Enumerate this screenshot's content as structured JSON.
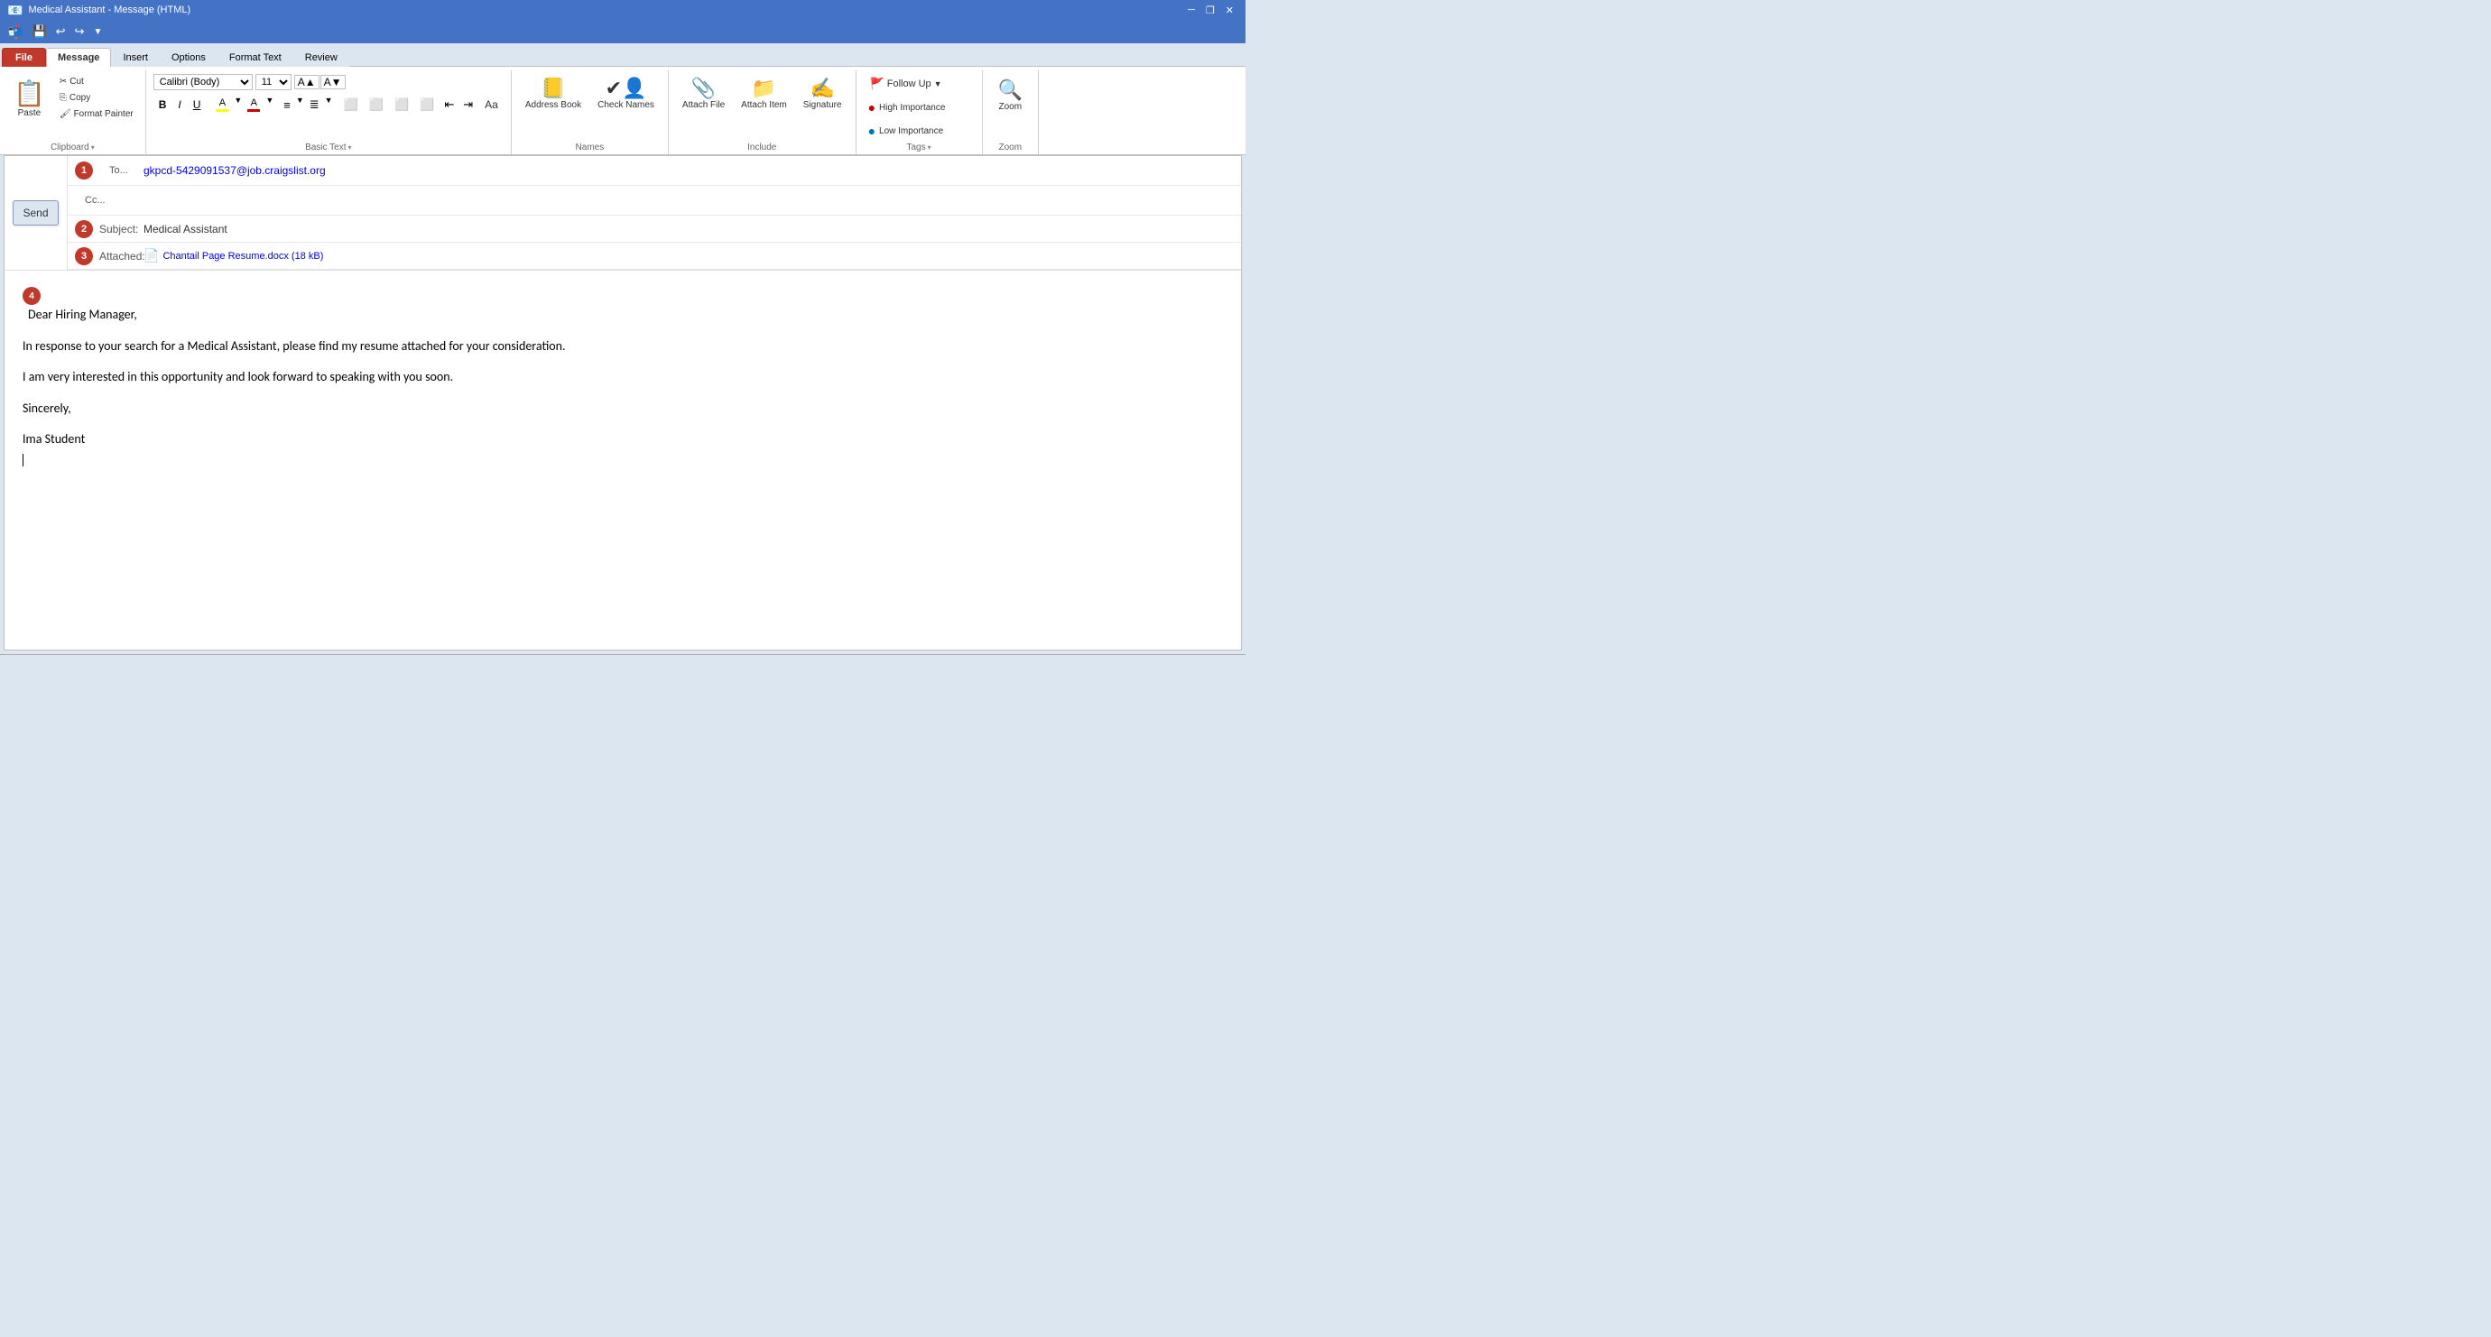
{
  "titlebar": {
    "title": "Medical Assistant - Message (HTML)",
    "controls": [
      "minimize",
      "restore",
      "close"
    ]
  },
  "quickaccess": {
    "buttons": [
      "save",
      "undo",
      "redo",
      "customize"
    ]
  },
  "ribbon": {
    "tabs": [
      "File",
      "Message",
      "Insert",
      "Options",
      "Format Text",
      "Review"
    ],
    "active_tab": "Message",
    "groups": {
      "clipboard": {
        "label": "Clipboard",
        "paste_label": "Paste",
        "cut_label": "Cut",
        "copy_label": "Copy",
        "format_painter_label": "Format Painter"
      },
      "basic_text": {
        "label": "Basic Text",
        "font": "Calibri (Body)",
        "font_size": "11",
        "bold": "B",
        "italic": "I",
        "underline": "U",
        "highlight_label": "Highlight",
        "font_color_label": "Font Color"
      },
      "names": {
        "label": "Names",
        "address_book_label": "Address Book",
        "check_names_label": "Check Names"
      },
      "include": {
        "label": "Include",
        "attach_file_label": "Attach File",
        "attach_item_label": "Attach Item",
        "signature_label": "Signature"
      },
      "tags": {
        "label": "Tags",
        "follow_up_label": "Follow Up",
        "high_importance_label": "High Importance",
        "low_importance_label": "Low Importance"
      },
      "zoom": {
        "label": "Zoom",
        "zoom_label": "Zoom"
      }
    }
  },
  "email": {
    "to_label": "To...",
    "to_value": "gkpcd-5429091537@job.craigslist.org",
    "cc_label": "Cc...",
    "cc_value": "",
    "subject_label": "Subject:",
    "subject_value": "Medical Assistant",
    "attached_label": "Attached:",
    "attached_filename": "Chantail Page Resume.docx (18 kB)",
    "send_label": "Send",
    "body": {
      "greeting": "Dear Hiring Manager,",
      "paragraph1": "In response to your search for a Medical Assistant, please find my resume attached for your consideration.",
      "paragraph2": "I am very interested in this opportunity and look forward to speaking with you soon.",
      "closing": "Sincerely,",
      "name": "Ima Student"
    },
    "badges": {
      "to_badge": "1",
      "subject_badge": "2",
      "attached_badge": "3",
      "body_badge": "4"
    }
  }
}
